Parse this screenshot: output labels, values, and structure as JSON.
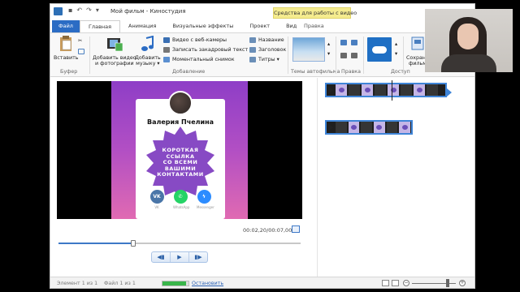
{
  "window": {
    "title": "Мой фильм - Киностудия",
    "context_tools_label": "Средства для работы с видео"
  },
  "tabs": {
    "file": "Файл",
    "home": "Главная",
    "animation": "Анимация",
    "visual_effects": "Визуальные эффекты",
    "project": "Проект",
    "view": "Вид",
    "edit": "Правка"
  },
  "ribbon": {
    "paste": "Вставить",
    "clipboard_group": "Буфер",
    "add_video_photos_l1": "Добавить видео",
    "add_video_photos_l2": "и фотографии",
    "add_music_l1": "Добавить",
    "add_music_l2": "музыку ▾",
    "webcam_video": "Видео с веб-камеры",
    "record_narration": "Записать закадровый текст ▾",
    "snapshot": "Моментальный снимок",
    "title_btn": "Название",
    "caption_btn": "Заголовок",
    "credits_btn": "Титры ▾",
    "add_group": "Добавление",
    "autotheme_group": "Темы автофильма",
    "edit_group": "Правка",
    "access_group": "Доступ",
    "save_movie_l1": "Сохрани",
    "save_movie_l2": "фильм"
  },
  "preview": {
    "profile_name": "Валерия Пчелина",
    "badge_lines": [
      "КОРОТКАЯ",
      "ССЫЛКА",
      "СО ВСЕМИ",
      "ВАШИМИ",
      "КОНТАКТАМИ"
    ],
    "social_labels": [
      "VK",
      "WhatsApp",
      "Messenger"
    ],
    "vk_text": "VK",
    "time_readout": "00:02,20/00:07,00",
    "seek_progress": 0.31
  },
  "status": {
    "element": "Элемент 1 из 1",
    "file": "Файл 1 из 1",
    "stop_link": "Остановить",
    "file_progress": 0.92,
    "zoom_level": 0.82
  },
  "colors": {
    "accent": "#2b6cc4",
    "context_tools": "#f5ec8f",
    "clip_border": "#3f85d8",
    "progress_green": "#39b54a"
  }
}
